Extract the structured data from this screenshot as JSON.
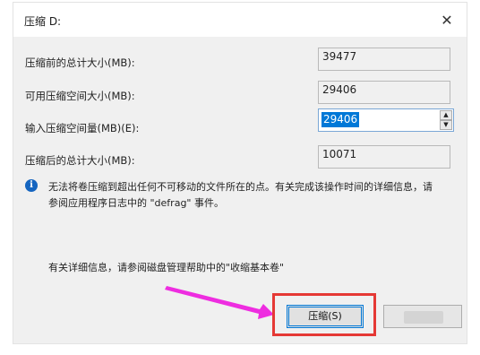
{
  "dialog": {
    "title": "压缩 D:",
    "close_symbol": "✕"
  },
  "fields": {
    "total_before_label": "压缩前的总计大小(MB):",
    "total_before_value": "39477",
    "available_label": "可用压缩空间大小(MB):",
    "available_value": "29406",
    "input_label": "输入压缩空间量(MB)(E):",
    "input_value": "29406",
    "total_after_label": "压缩后的总计大小(MB):",
    "total_after_value": "10071"
  },
  "info": {
    "icon_glyph": "i",
    "line1": "无法将卷压缩到超出任何不可移动的文件所在的点。有关完成该操作时间的详细信息，请",
    "line2": "参阅应用程序日志中的 \"defrag\" 事件。"
  },
  "help": {
    "text": "有关详细信息，请参阅磁盘管理帮助中的\"收缩基本卷\""
  },
  "buttons": {
    "shrink_label": "压缩(S)",
    "spin_up": "▲",
    "spin_down": "▼"
  },
  "colors": {
    "highlight": "#e53935",
    "arrow": "#ee2de0",
    "selection": "#0078d7",
    "info_icon": "#1565c0"
  }
}
